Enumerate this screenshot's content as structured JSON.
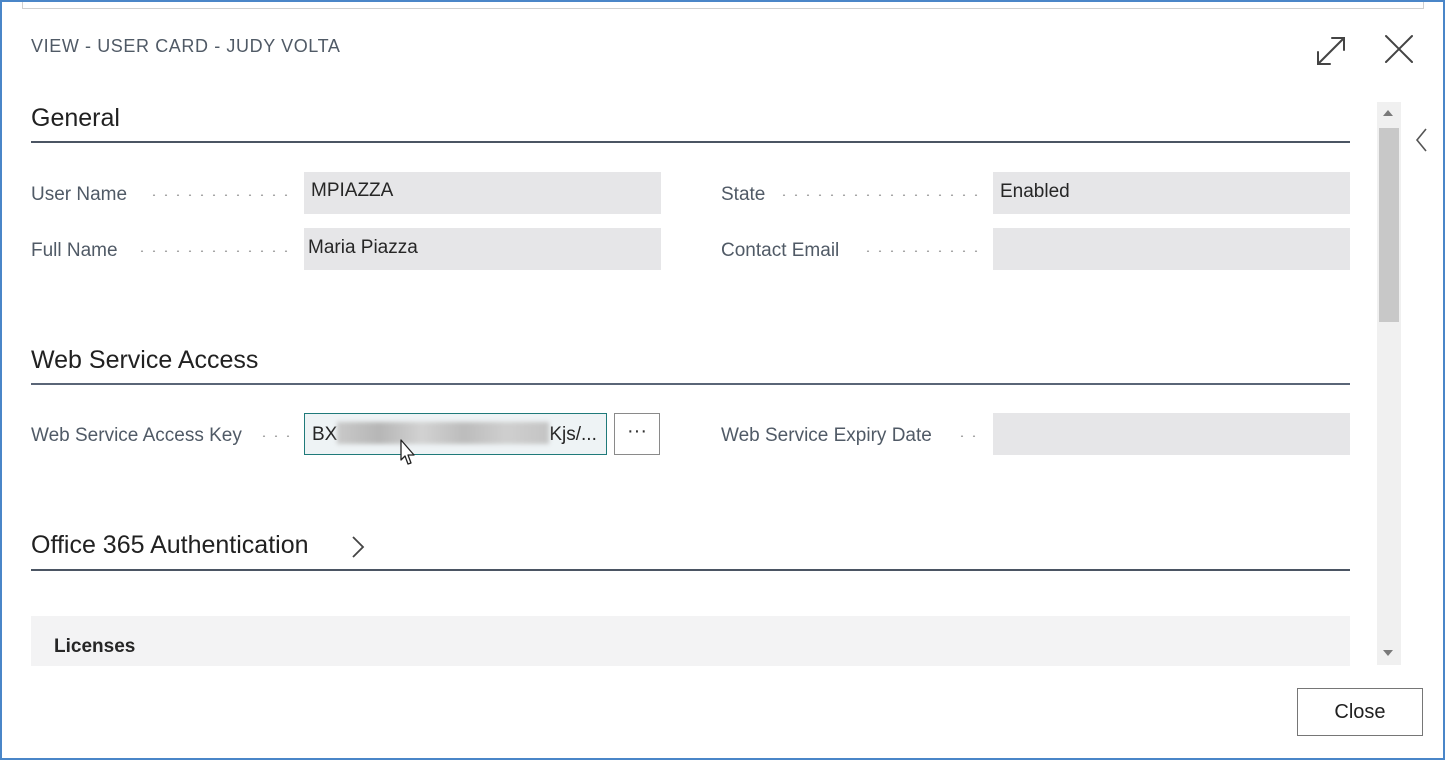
{
  "dialog": {
    "title": "VIEW - USER CARD - JUDY VOLTA",
    "icons": {
      "expand": "expand-arrows-icon",
      "close": "close-x-icon",
      "factbox_toggle": "chevron-left-icon"
    }
  },
  "general": {
    "title": "General",
    "user_name_label": "User Name",
    "user_name_value": "MPIAZZA",
    "full_name_label": "Full Name",
    "full_name_value": "Maria Piazza",
    "state_label": "State",
    "state_value": "Enabled",
    "contact_email_label": "Contact Email",
    "contact_email_value": ""
  },
  "web_service": {
    "title": "Web Service Access",
    "key_label": "Web Service Access Key",
    "key_value_start": "BX",
    "key_value_end": "Kjs/...",
    "assist_button_label": "···",
    "expiry_label": "Web Service Expiry Date",
    "expiry_value": ""
  },
  "office365": {
    "title": "Office 365 Authentication",
    "icon": "chevron-right-icon"
  },
  "licenses": {
    "title": "Licenses"
  },
  "footer": {
    "close_label": "Close"
  }
}
